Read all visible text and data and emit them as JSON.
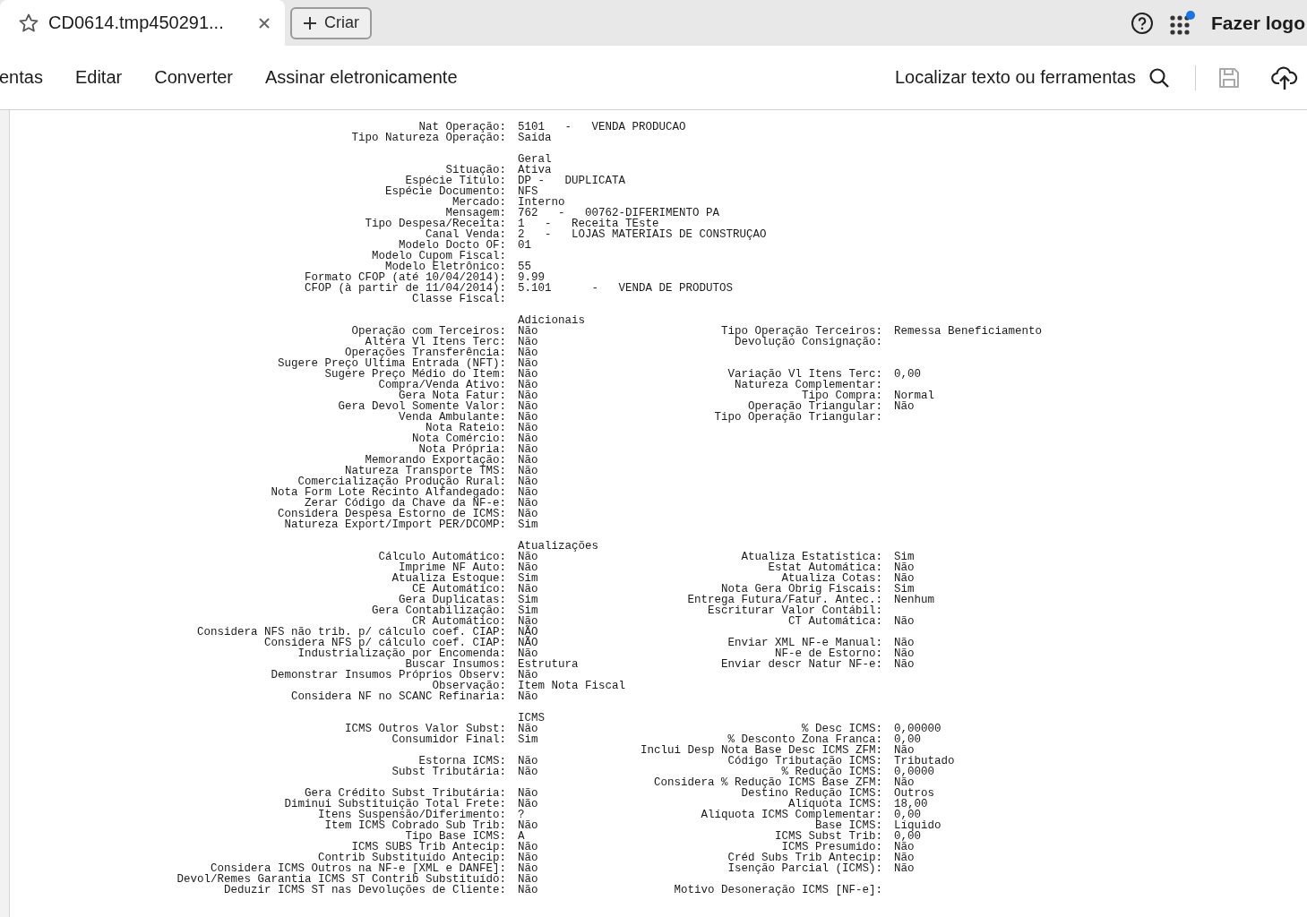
{
  "tab": {
    "title": "CD0614.tmp450291..."
  },
  "create_button": {
    "label": "Criar"
  },
  "apps": {
    "notification": true
  },
  "account": {
    "label": "Fazer logo"
  },
  "menu": [
    {
      "label": "entas"
    },
    {
      "label": "Editar"
    },
    {
      "label": "Converter"
    },
    {
      "label": "Assinar eletronicamente"
    }
  ],
  "find": {
    "label": "Localizar texto ou ferramentas"
  },
  "save": {
    "disabled": true
  },
  "document": {
    "sections": [
      {
        "rows": [
          {
            "label": "Nat Operação:",
            "value": "5101   -   VENDA PRODUCAO"
          },
          {
            "label": "Tipo Natureza Operação:",
            "value": "Saída"
          }
        ]
      },
      {
        "title": "Geral",
        "rows": [
          {
            "label": "Situação:",
            "value": "Ativa"
          },
          {
            "label": "Espécie Título:",
            "value": "DP -   DUPLICATA"
          },
          {
            "label": "Espécie Documento:",
            "value": "NFS"
          },
          {
            "label": "Mercado:",
            "value": "Interno"
          },
          {
            "label": "Mensagem:",
            "value": "762   -   00762-DIFERIMENTO PA"
          },
          {
            "label": "Tipo Despesa/Receita:",
            "value": "1   -   Receita TEste"
          },
          {
            "label": "Canal Venda:",
            "value": "2   -   LOJAS MATERIAIS DE CONSTRUÇAO"
          },
          {
            "label": "Modelo Docto OF:",
            "value": "01"
          },
          {
            "label": "Modelo Cupom Fiscal:"
          },
          {
            "label": "Modelo Eletrônico:",
            "value": "55"
          },
          {
            "label": "Formato CFOP (até 10/04/2014):",
            "value": "9.99"
          },
          {
            "label": "CFOP (à partir de 11/04/2014):",
            "value": "5.101      -   VENDA DE PRODUTOS"
          },
          {
            "label": "Classe Fiscal:"
          }
        ]
      },
      {
        "title": "Adicionais",
        "rows": [
          {
            "label": "Operação com Terceiros:",
            "value": "Não",
            "label_2": "Tipo Operação Terceiros:",
            "value_2": "Remessa Beneficiamento"
          },
          {
            "label": "Altera Vl Itens Terc:",
            "value": "Não",
            "label_2": "Devolução Consignação:"
          },
          {
            "label": "Operações Transferência:",
            "value": "Não"
          },
          {
            "label": "Sugere Preço Ultima Entrada (NFT):",
            "value": "Não"
          },
          {
            "label": "Sugere Preço Médio do Item:",
            "value": "Não",
            "label_2": "Variação Vl Itens Terc:",
            "value_2": "0,00"
          },
          {
            "label": "Compra/Venda Ativo:",
            "value": "Não",
            "label_2": "Natureza Complementar:"
          },
          {
            "label": "Gera Nota Fatur:",
            "value": "Não",
            "label_2": "Tipo Compra:",
            "value_2": "Normal"
          },
          {
            "label": "Gera Devol Somente Valor:",
            "value": "Não",
            "label_2": "Operação Triangular:",
            "value_2": "Não"
          },
          {
            "label": "Venda Ambulante:",
            "value": "Não",
            "label_2": "Tipo Operação Triangular:"
          },
          {
            "label": "Nota Rateio:",
            "value": "Não"
          },
          {
            "label": "Nota Comércio:",
            "value": "Não"
          },
          {
            "label": "Nota Própria:",
            "value": "Não"
          },
          {
            "label": "Memorando Exportação:",
            "value": "Não"
          },
          {
            "label": "Natureza Transporte TMS:",
            "value": "Não"
          },
          {
            "label": "Comercialização Produção Rural:",
            "value": "Não"
          },
          {
            "label": "Nota Form Lote Recinto Alfandegado:",
            "value": "Não"
          },
          {
            "label": "Zerar Código da Chave da NF-e:",
            "value": "Não"
          },
          {
            "label": "Considera Despesa Estorno de ICMS:",
            "value": "Não"
          },
          {
            "label": "Natureza Export/Import PER/DCOMP:",
            "value": "Sim"
          }
        ]
      },
      {
        "title": "Atualizações",
        "rows": [
          {
            "label": "Cálculo Automático:",
            "value": "Não",
            "label_2": "Atualiza Estatística:",
            "value_2": "Sim"
          },
          {
            "label": "Imprime NF Auto:",
            "value": "Não",
            "label_2": "Estat Automática:",
            "value_2": "Não"
          },
          {
            "label": "Atualiza Estoque:",
            "value": "Sim",
            "label_2": "Atualiza Cotas:",
            "value_2": "Não"
          },
          {
            "label": "CE Automático:",
            "value": "Não",
            "label_2": "Nota Gera Obrig Fiscais:",
            "value_2": "Sim"
          },
          {
            "label": "Gera Duplicatas:",
            "value": "Sim",
            "label_2": "Entrega Futura/Fatur. Antec.:",
            "value_2": "Nenhum"
          },
          {
            "label": "Gera Contabilização:",
            "value": "Sim",
            "label_2": "Escriturar Valor Contábil:"
          },
          {
            "label": "CR Automático:",
            "value": "Não",
            "label_2": "CT Automática:",
            "value_2": "Não"
          },
          {
            "label": "Considera NFS não trib. p/ cálculo coef. CIAP:",
            "value": "NÃO"
          },
          {
            "label": "Considera NFS p/ cálculo coef. CIAP:",
            "value": "NÃO",
            "label_2": "Enviar XML NF-e Manual:",
            "value_2": "Não"
          },
          {
            "label": "Industrialização por Encomenda:",
            "value": "Não",
            "label_2": "NF-e de Estorno:",
            "value_2": "Não"
          },
          {
            "label": "Buscar Insumos:",
            "value": "Estrutura",
            "label_2": "Enviar descr Natur NF-e:",
            "value_2": "Não"
          },
          {
            "label": "Demonstrar Insumos Próprios Observ:",
            "value": "Não"
          },
          {
            "label": "Observação:",
            "value": "Item Nota Fiscal"
          },
          {
            "label": "Considera NF no SCANC Refinaria:",
            "value": "Não"
          }
        ]
      },
      {
        "title": "ICMS",
        "rows": [
          {
            "label": "ICMS Outros Valor Subst:",
            "value": "Não",
            "label_2": "% Desc ICMS:",
            "value_2": "0,00000"
          },
          {
            "label": "Consumidor Final:",
            "value": "Sim",
            "label_2": "% Desconto Zona Franca:",
            "value_2": "0,00"
          },
          {
            "label_2": "Inclui Desp Nota Base Desc ICMS ZFM:",
            "value_2": "Não"
          },
          {
            "label": "Estorna ICMS:",
            "value": "Não",
            "label_2": "Código Tributação ICMS:",
            "value_2": "Tributado"
          },
          {
            "label": "Subst Tributária:",
            "value": "Não",
            "label_2": "% Redução ICMS:",
            "value_2": "0,0000"
          },
          {
            "label_2": "Considera % Redução ICMS Base ZFM:",
            "value_2": "Não"
          },
          {
            "label": "Gera Crédito Subst Tributária:",
            "value": "Não",
            "label_2": "Destino Redução ICMS:",
            "value_2": "Outros"
          },
          {
            "label": "Diminui Substituição Total Frete:",
            "value": "Não",
            "label_2": "Alíquota ICMS:",
            "value_2": "18,00"
          },
          {
            "label": "Itens Suspensão/Diferimento:",
            "value": "?",
            "label_2": "Alíquota ICMS Complementar:",
            "value_2": "0,00"
          },
          {
            "label": "Item ICMS Cobrado Sub Trib:",
            "value": "Não",
            "label_2": "Base ICMS:",
            "value_2": "Líquido"
          },
          {
            "label": "Tipo Base ICMS:",
            "value": "A",
            "label_2": "ICMS Subst Trib:",
            "value_2": "0,00"
          },
          {
            "label": "ICMS SUBS Trib Antecip:",
            "value": "Não",
            "label_2": "ICMS Presumido:",
            "value_2": "Não"
          },
          {
            "label": "Contrib Substituído Antecip:",
            "value": "Não",
            "label_2": "Créd Subs Trib Antecip:",
            "value_2": "Não"
          },
          {
            "label": "Considera ICMS Outros na NF-e [XML e DANFE]:",
            "value": "Não",
            "label_2": "Isenção Parcial (ICMS):",
            "value_2": "Não"
          },
          {
            "label": "Devol/Remes Garantia ICMS ST Contrib Substituído:",
            "value": "Não"
          },
          {
            "label": "Deduzir ICMS ST nas Devoluções de Cliente:",
            "value": "Não",
            "label_2": "Motivo Desoneração ICMS [NF-e]:"
          }
        ]
      }
    ]
  }
}
